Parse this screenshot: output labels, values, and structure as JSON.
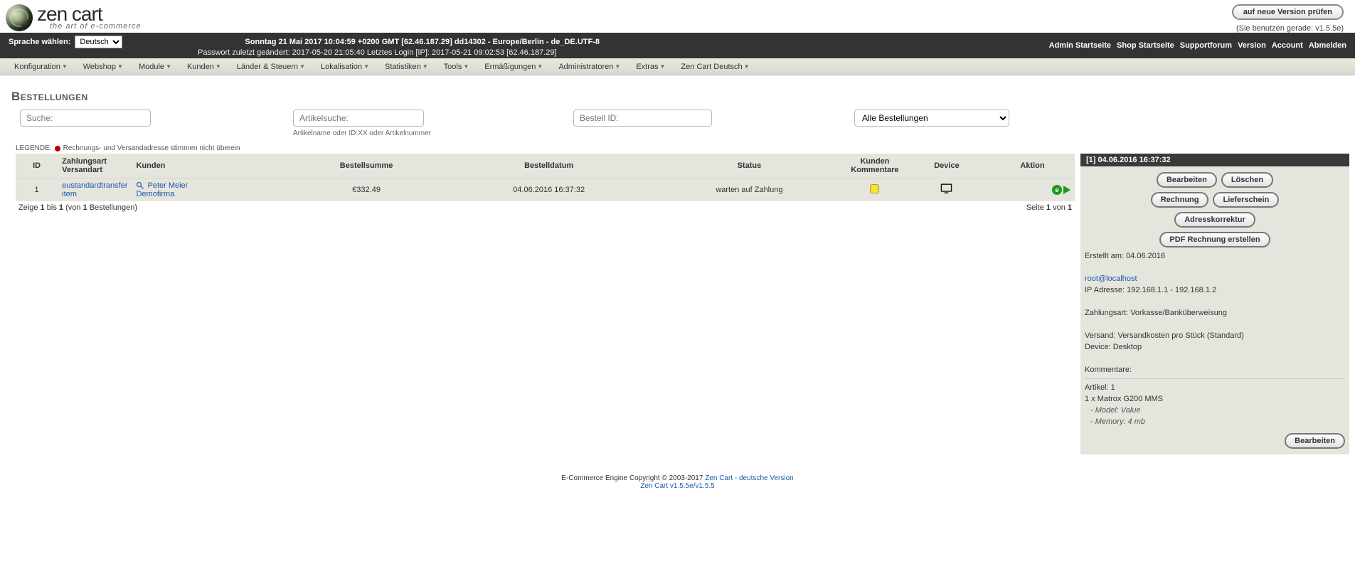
{
  "logo": {
    "title": "zen cart",
    "subtitle": "the art of e-commerce"
  },
  "version_btn": "auf neue Version prüfen",
  "version_note": "(Sie benutzen gerade: v1.5.5e)",
  "topbar": {
    "lang_label": "Sprache wählen:",
    "lang_selected": "Deutsch",
    "line1": "Sonntag 21 Mai 2017 10:04:59 +0200 GMT [62.46.187.29]   dd14302 - Europe/Berlin - de_DE.UTF-8",
    "line2": "Passwort zuletzt geändert: 2017-05-20 21:05:40   Letztes Login [IP]: 2017-05-21 09:02:53 [62.46.187.29]",
    "links": [
      "Admin Startseite",
      "Shop Startseite",
      "Supportforum",
      "Version",
      "Account",
      "Abmelden"
    ]
  },
  "menu": [
    "Konfiguration",
    "Webshop",
    "Module",
    "Kunden",
    "Länder & Steuern",
    "Lokalisation",
    "Statistiken",
    "Tools",
    "Ermäßigungen",
    "Administratoren",
    "Extras",
    "Zen Cart Deutsch"
  ],
  "page_title": "Bestellungen",
  "filters": {
    "search_ph": "Suche:",
    "article_ph": "Artikelsuche:",
    "article_hint": "Artikelname oder ID:XX oder Artikelnummer",
    "orderid_ph": "Bestell ID:",
    "status_selected": "Alle Bestellungen"
  },
  "legend": {
    "label": "LEGENDE:",
    "text": "Rechnungs- und Versandadresse stimmen nicht überein"
  },
  "columns": [
    "ID",
    "Zahlungsart Versandart",
    "Kunden",
    "Bestellsumme",
    "Bestelldatum",
    "Status",
    "Kunden Kommentare",
    "Device",
    "Aktion"
  ],
  "row": {
    "id": "1",
    "pay": "eustandardtransfer",
    "ship": "item",
    "cust1": "Peter Meier",
    "cust2": "Demofirma",
    "sum": "€332.49",
    "date": "04.06.2016 16:37:32",
    "status": "warten auf Zahlung"
  },
  "pager": {
    "left_a": "Zeige ",
    "left_b": "1",
    "left_c": " bis ",
    "left_d": "1",
    "left_e": " (von ",
    "left_f": "1",
    "left_g": " Bestellungen)",
    "right_a": "Seite ",
    "right_b": "1",
    "right_c": " von ",
    "right_d": "1"
  },
  "sidebar": {
    "head": "[1]  04.06.2016 16:37:32",
    "buttons": {
      "edit": "Bearbeiten",
      "del": "Löschen",
      "invoice": "Rechnung",
      "packing": "Lieferschein",
      "addr": "Adresskorrektur",
      "pdf": "PDF Rechnung erstellen",
      "edit2": "Bearbeiten"
    },
    "created": "Erstellt am: 04.06.2016",
    "email": "root@localhost",
    "ip": "IP Adresse: 192.168.1.1 - 192.168.1.2",
    "payment": "Zahlungsart: Vorkasse/Banküberweisung",
    "shipping": "Versand: Versandkosten pro Stück (Standard)",
    "device": "Device: Desktop",
    "comments": "Kommentare:",
    "articles": "Artikel: 1",
    "art_line": "1 x Matrox G200 MMS",
    "attr1": "- Model: Value",
    "attr2": "- Memory: 4 mb"
  },
  "footer": {
    "line1a": "E-Commerce Engine Copyright © 2003-2017 ",
    "link1": "Zen Cart",
    "line1b": " - ",
    "link2": "deutsche Version",
    "line2": "Zen Cart v1.5.5e/v1.5.5"
  }
}
